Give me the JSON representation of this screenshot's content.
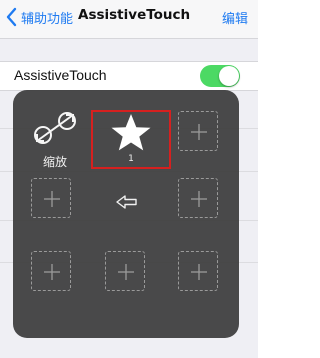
{
  "nav": {
    "back_label": "辅助功能",
    "title": "AssistiveTouch",
    "edit_label": "编辑"
  },
  "settings": {
    "row_label": "AssistiveTouch",
    "toggle_on": true
  },
  "panel": {
    "zoom_label": "缩放",
    "custom_number": "1"
  },
  "colors": {
    "accent": "#1f7bf1",
    "toggle_on": "#4cd964",
    "panel_bg": "#3c3c3c",
    "selection_border": "#d6201f"
  },
  "icons": [
    "chevron-left-icon",
    "zoom-arrows-icon",
    "star-icon",
    "plus-icon",
    "back-arrow-icon"
  ]
}
